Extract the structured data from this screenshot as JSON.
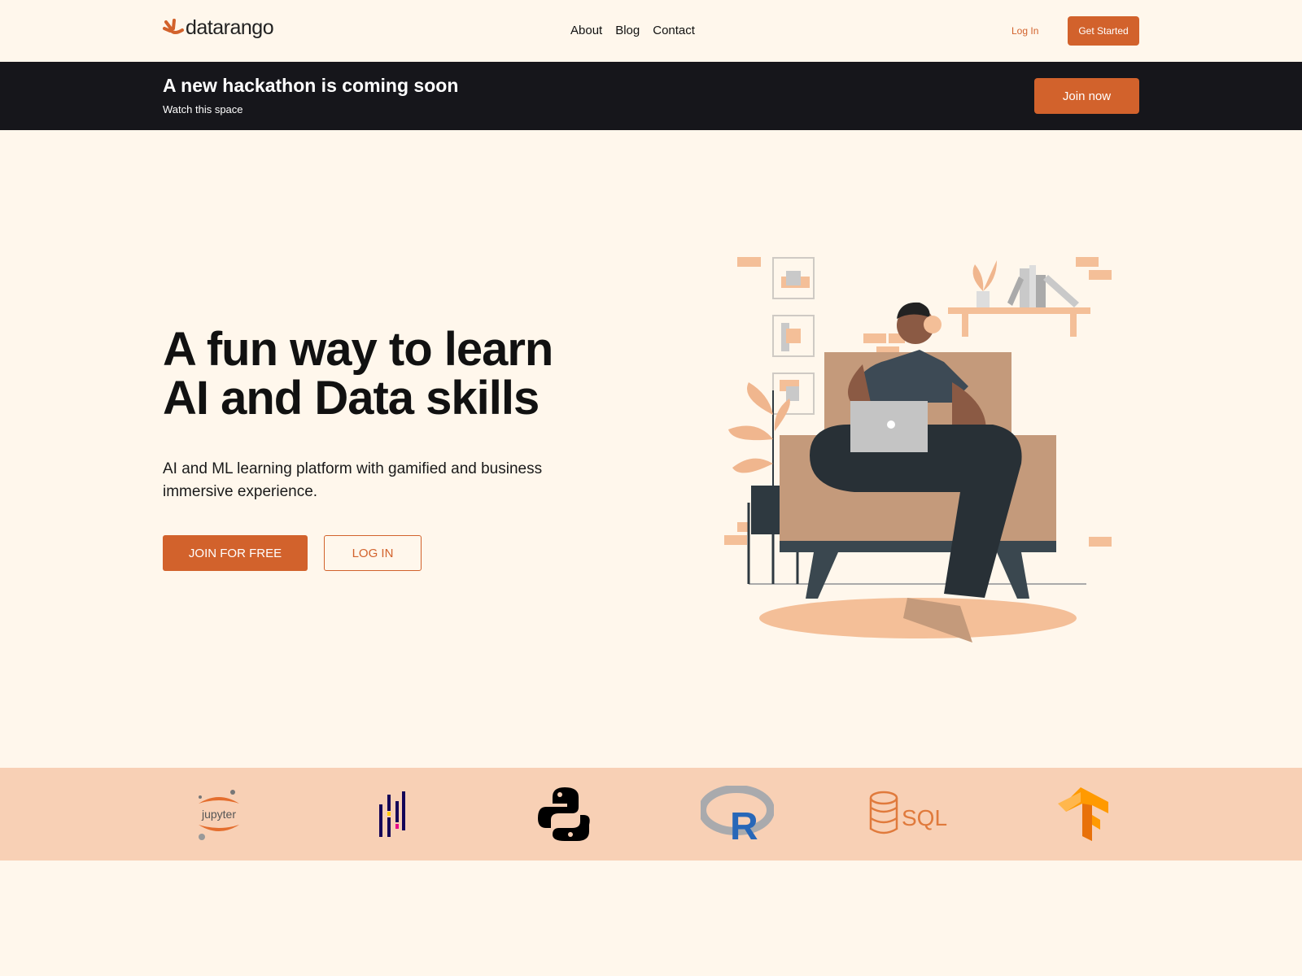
{
  "nav": {
    "logo_text": "datarango",
    "links": [
      "About",
      "Blog",
      "Contact"
    ],
    "login": "Log In",
    "get_started": "Get Started"
  },
  "banner": {
    "title": "A new hackathon is coming soon",
    "subtitle": "Watch this space",
    "cta": "Join now"
  },
  "hero": {
    "title_line1": "A fun way to learn",
    "title_line2": "AI and Data skills",
    "subtitle": "AI and ML learning platform with gamified and business immersive experience.",
    "join_button": "JOIN FOR FREE",
    "login_button": "LOG IN"
  },
  "tools": [
    {
      "name": "jupyter",
      "icon": "jupyter-logo"
    },
    {
      "name": "pandas",
      "icon": "pandas-logo"
    },
    {
      "name": "python",
      "icon": "python-logo"
    },
    {
      "name": "R",
      "icon": "r-logo"
    },
    {
      "name": "SQL",
      "icon": "sql-logo"
    },
    {
      "name": "tensorflow",
      "icon": "tensorflow-logo"
    }
  ],
  "colors": {
    "accent": "#d2622c",
    "banner": "#16161b",
    "background": "#fff7ec",
    "strip": "#f8d0b5"
  }
}
